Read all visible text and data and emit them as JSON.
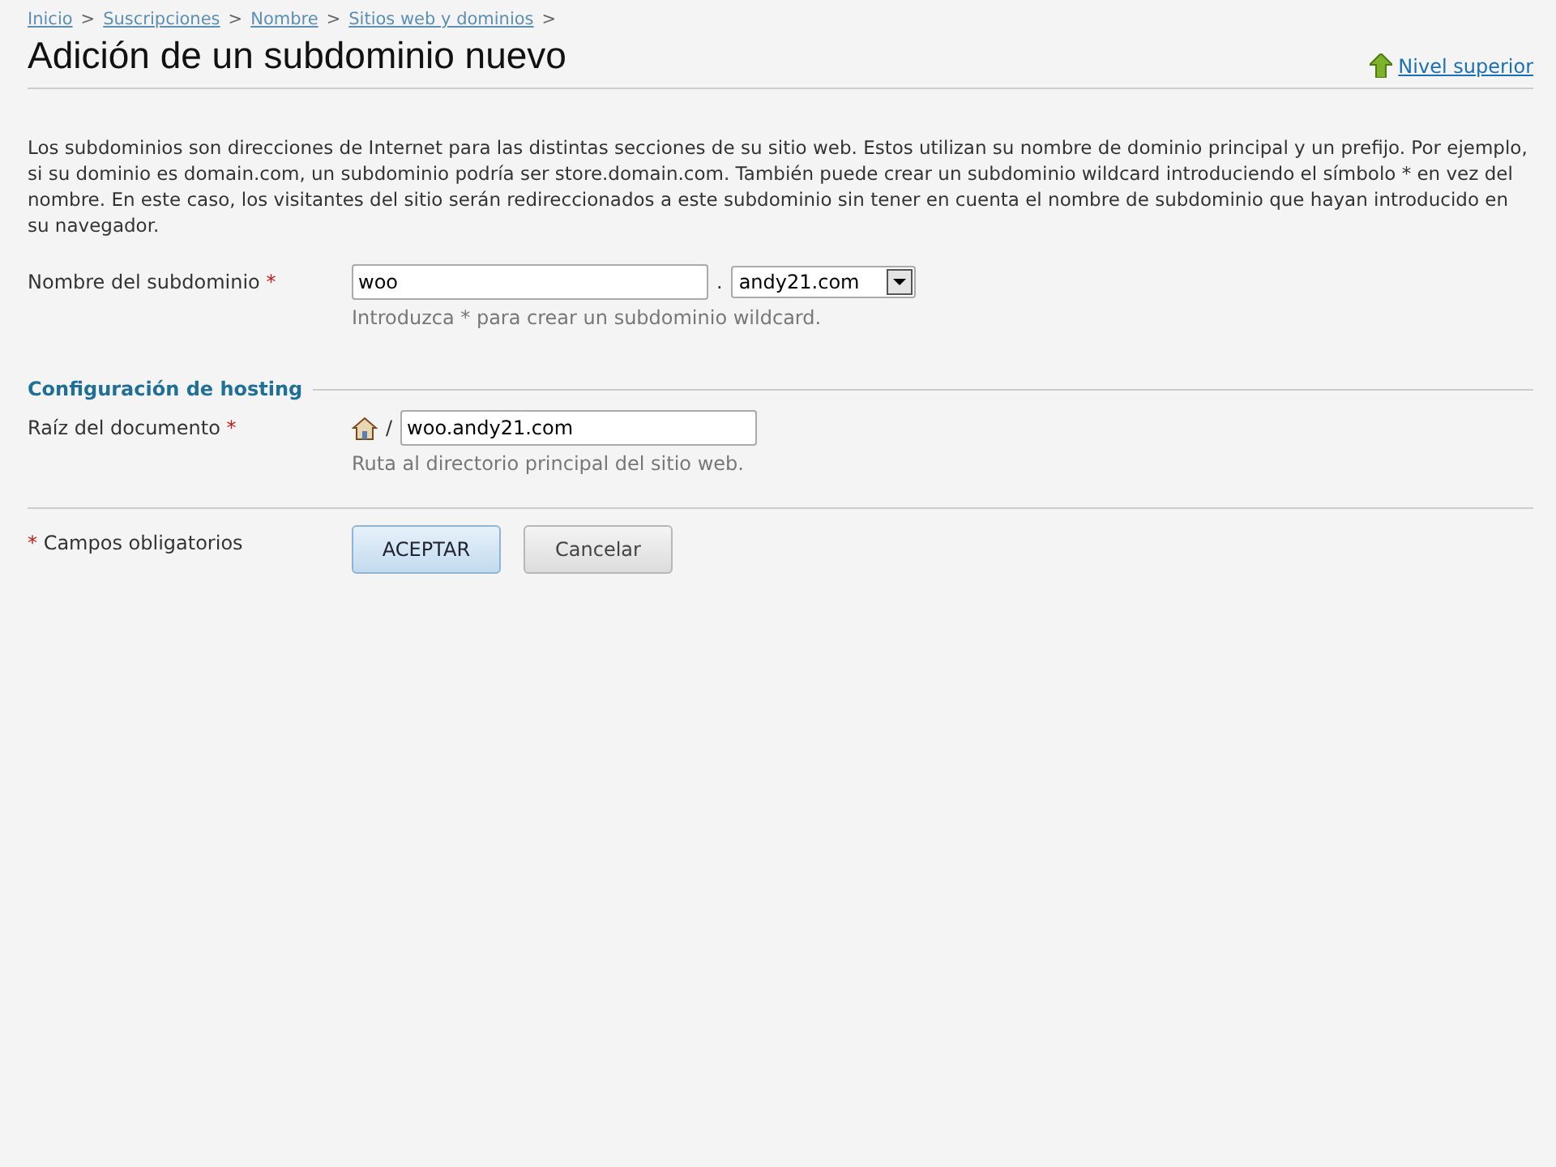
{
  "breadcrumbs": [
    {
      "label": "Inicio"
    },
    {
      "label": "Suscripciones"
    },
    {
      "label": "Nombre"
    },
    {
      "label": "Sitios web y dominios"
    }
  ],
  "breadcrumb_separator": ">",
  "title": "Adición de un subdominio nuevo",
  "up_link": "Nivel superior",
  "description": "Los subdominios son direcciones de Internet para las distintas secciones de su sitio web. Estos utilizan su nombre de dominio principal y un prefijo. Por ejemplo, si su dominio es domain.com, un subdominio podría ser store.domain.com. También puede crear un subdominio wildcard introduciendo el símbolo * en vez del nombre. En este caso, los visitantes del sitio serán redireccionados a este subdominio sin tener en cuenta el nombre de subdominio que hayan introducido en su navegador.",
  "subdomain": {
    "label": "Nombre del subdominio",
    "required_mark": "*",
    "value": "woo",
    "separator": ".",
    "domain": "andy21.com",
    "hint": "Introduzca * para crear un subdominio wildcard."
  },
  "hosting": {
    "heading": "Configuración de hosting",
    "document_root": {
      "label": "Raíz del documento",
      "required_mark": "*",
      "prefix": "/",
      "value": "woo.andy21.com",
      "hint": "Ruta al directorio principal del sitio web."
    }
  },
  "footer": {
    "required_mark": "*",
    "required_note": "Campos obligatorios",
    "buttons": [
      {
        "label": "ACEPTAR",
        "kind": "primary"
      },
      {
        "label": "Cancelar",
        "kind": "secondary"
      }
    ]
  }
}
